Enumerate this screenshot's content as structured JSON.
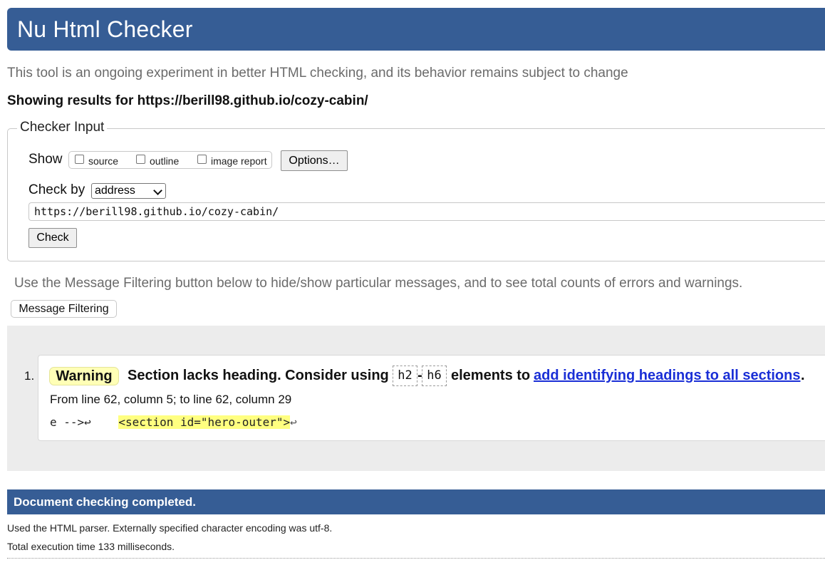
{
  "header": {
    "title": "Nu Html Checker"
  },
  "intro": "This tool is an ongoing experiment in better HTML checking, and its behavior remains subject to change",
  "showing": "Showing results for https://berill98.github.io/cozy-cabin/",
  "checker_input": {
    "legend": "Checker Input",
    "show_label": "Show",
    "show_options": [
      "source",
      "outline",
      "image report"
    ],
    "options_button": "Options…",
    "check_by_label": "Check by",
    "check_by_value": "address",
    "url": "https://berill98.github.io/cozy-cabin/",
    "check_button": "Check"
  },
  "filter_note": "Use the Message Filtering button below to hide/show particular messages, and to see total counts of errors and warnings.",
  "filter_button": "Message Filtering",
  "messages": [
    {
      "number": "1.",
      "type": "Warning",
      "text_before": "Section lacks heading. Consider using",
      "code_from": "h2",
      "dash": "-",
      "code_to": "h6",
      "text_middle": "elements to",
      "link_text": "add identifying headings to all sections",
      "text_after": ".",
      "location": "From line 62, column 5; to line 62, column 29",
      "extract_before": "e -->↩    ",
      "extract_highlight": "<section id=\"hero-outer\">",
      "extract_after": "↩"
    }
  ],
  "footer": {
    "completed": "Document checking completed.",
    "parser_note": "Used the HTML parser. Externally specified character encoding was utf-8.",
    "timing": "Total execution time 133 milliseconds."
  },
  "colors": {
    "brand": "#365d95",
    "warning_bg": "#ffffb6",
    "link": "#1a2fd6"
  }
}
